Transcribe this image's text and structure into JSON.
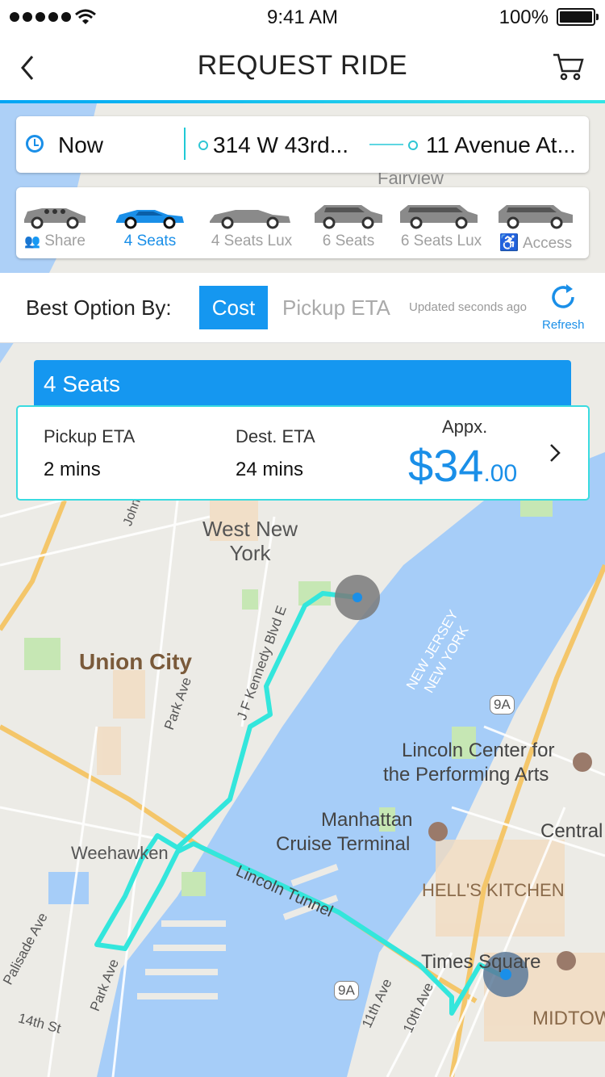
{
  "status_bar": {
    "time": "9:41 AM",
    "battery": "100%"
  },
  "header": {
    "title": "REQUEST RIDE"
  },
  "location": {
    "time_label": "Now",
    "pickup": "314 W 43rd...",
    "destination": "11 Avenue At..."
  },
  "vehicles": [
    {
      "label": "Share",
      "icon": "users-icon",
      "selected": false
    },
    {
      "label": "4 Seats",
      "selected": true
    },
    {
      "label": "4 Seats Lux",
      "selected": false
    },
    {
      "label": "6 Seats",
      "selected": false
    },
    {
      "label": "6 Seats Lux",
      "selected": false
    },
    {
      "label": "Access",
      "icon": "wheelchair-icon",
      "selected": false
    }
  ],
  "best_option": {
    "label": "Best Option By:",
    "cost": "Cost",
    "pickup_eta": "Pickup ETA",
    "updated": "Updated seconds ago",
    "refresh": "Refresh"
  },
  "ride": {
    "title": "4 Seats",
    "pickup_eta_label": "Pickup ETA",
    "pickup_eta": "2 mins",
    "dest_eta_label": "Dest. ETA",
    "dest_eta": "24 mins",
    "appx_label": "Appx.",
    "price_main": "$34",
    "price_cents": ".00"
  },
  "map_labels": {
    "fairview": "Fairview",
    "west_new_york": "West New York",
    "union_city": "Union City",
    "jfk_blvd_north": "John F. Kenn",
    "jfk_blvd": "J F Kennedy Blvd E",
    "park_ave": "Park Ave",
    "park_ave_south": "Park Ave",
    "weehawken": "Weehawken",
    "palisade_ave": "Palisade Ave",
    "fourteenth_st": "14th St",
    "nj_ny_1": "NEW JERSEY",
    "nj_ny_2": "NEW YORK",
    "route_9a": "9A",
    "route_9a_south": "9A",
    "lincoln_center_1": "Lincoln Center for",
    "lincoln_center_2": "the Performing Arts",
    "manhattan_cruise_1": "Manhattan",
    "manhattan_cruise_2": "Cruise Terminal",
    "central": "Central",
    "hells_kitchen": "HELL'S KITCHEN",
    "lincoln_tunnel": "Lincoln Tunnel",
    "times_square": "Times Square",
    "midtown": "MIDTOW",
    "eleventh_ave": "11th Ave",
    "tenth_ave": "10th Ave"
  },
  "colors": {
    "accent": "#1597f0",
    "route": "#33e6dc",
    "water": "#a6cdf8",
    "land": "#ecebe6"
  }
}
